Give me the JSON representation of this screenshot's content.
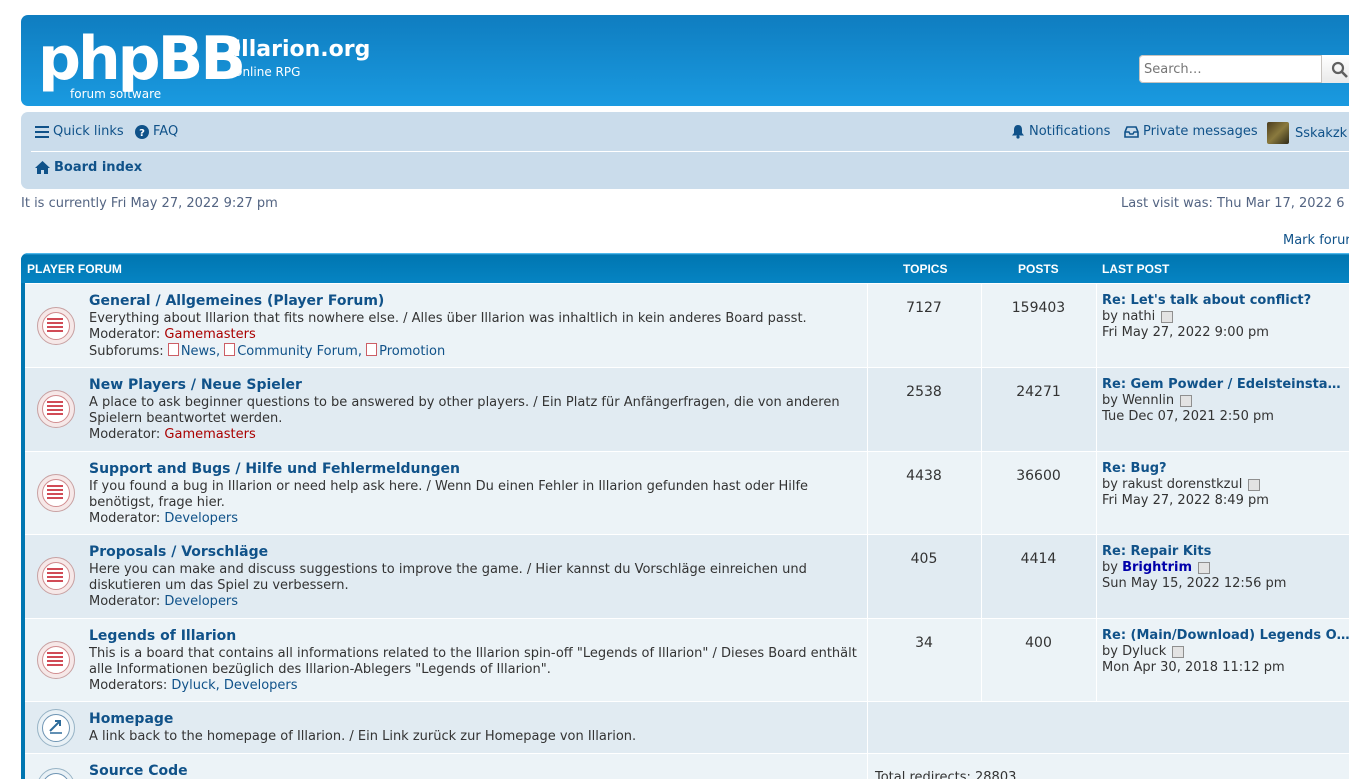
{
  "header": {
    "logo_text": "phpBB",
    "logo_sub": "forum software",
    "site_name": "Illarion.org",
    "site_desc": "Online RPG",
    "search_placeholder": "Search…"
  },
  "nav": {
    "quick_links": "Quick links",
    "faq": "FAQ",
    "notifications": "Notifications",
    "private_messages": "Private messages",
    "username": "Sskakzk",
    "board_index": "Board index"
  },
  "info": {
    "current_time": "It is currently Fri May 27, 2022 9:27 pm",
    "last_visit": "Last visit was: Thu Mar 17, 2022 6",
    "mark_forums": "Mark forur"
  },
  "forum_header": {
    "title": "PLAYER FORUM",
    "topics": "TOPICS",
    "posts": "POSTS",
    "last_post": "LAST POST"
  },
  "forums": [
    {
      "title": "General / Allgemeines (Player Forum)",
      "desc": "Everything about Illarion that fits nowhere else. / Alles über Illarion was inhaltlich in kein anderes Board passt.",
      "mod_label": "Moderator:",
      "mods": "Gamemasters",
      "subforums_label": "Subforums:",
      "subforums": [
        "News,",
        "Community Forum,",
        "Promotion"
      ],
      "topics": "7127",
      "posts": "159403",
      "lp_title": "Re: Let's talk about conflict?",
      "lp_by": "by",
      "lp_user": "nathi",
      "lp_date": "Fri May 27, 2022 9:00 pm"
    },
    {
      "title": "New Players / Neue Spieler",
      "desc": "A place to ask beginner questions to be answered by other players. / Ein Platz für Anfängerfragen, die von anderen Spielern beantwortet werden.",
      "mod_label": "Moderator:",
      "mods": "Gamemasters",
      "topics": "2538",
      "posts": "24271",
      "lp_title": "Re: Gem Powder / Edelsteinsta…",
      "lp_by": "by",
      "lp_user": "Wennlin",
      "lp_date": "Tue Dec 07, 2021 2:50 pm"
    },
    {
      "title": "Support and Bugs / Hilfe und Fehlermeldungen",
      "desc": "If you found a bug in Illarion or need help ask here. / Wenn Du einen Fehler in Illarion gefunden hast oder Hilfe benötigst, frage hier.",
      "mod_label": "Moderator:",
      "mods": "Developers",
      "topics": "4438",
      "posts": "36600",
      "lp_title": "Re: Bug?",
      "lp_by": "by",
      "lp_user": "rakust dorenstkzul",
      "lp_date": "Fri May 27, 2022 8:49 pm"
    },
    {
      "title": "Proposals / Vorschläge",
      "desc": "Here you can make and discuss suggestions to improve the game. / Hier kannst du Vorschläge einreichen und diskutieren um das Spiel zu verbessern.",
      "mod_label": "Moderator:",
      "mods": "Developers",
      "topics": "405",
      "posts": "4414",
      "lp_title": "Re: Repair Kits",
      "lp_by": "by",
      "lp_user": "Brightrim",
      "lp_date": "Sun May 15, 2022 12:56 pm"
    },
    {
      "title": "Legends of Illarion",
      "desc": "This is a board that contains all informations related to the Illarion spin-off \"Legends of Illarion\" / Dieses Board enthält alle Informationen bezüglich des Illarion-Ablegers \"Legends of Illarion\".",
      "mod_label": "Moderators:",
      "mods": "Dyluck, Developers",
      "topics": "34",
      "posts": "400",
      "lp_title": "Re: (Main/Download) Legends O…",
      "lp_by": "by",
      "lp_user": "Dyluck",
      "lp_date": "Mon Apr 30, 2018 11:12 pm"
    },
    {
      "title": "Homepage",
      "desc": "A link back to the homepage of Illarion. / Ein Link zurück zur Homepage von Illarion."
    },
    {
      "title": "Source Code",
      "redirects": "Total redirects: 28803"
    }
  ]
}
